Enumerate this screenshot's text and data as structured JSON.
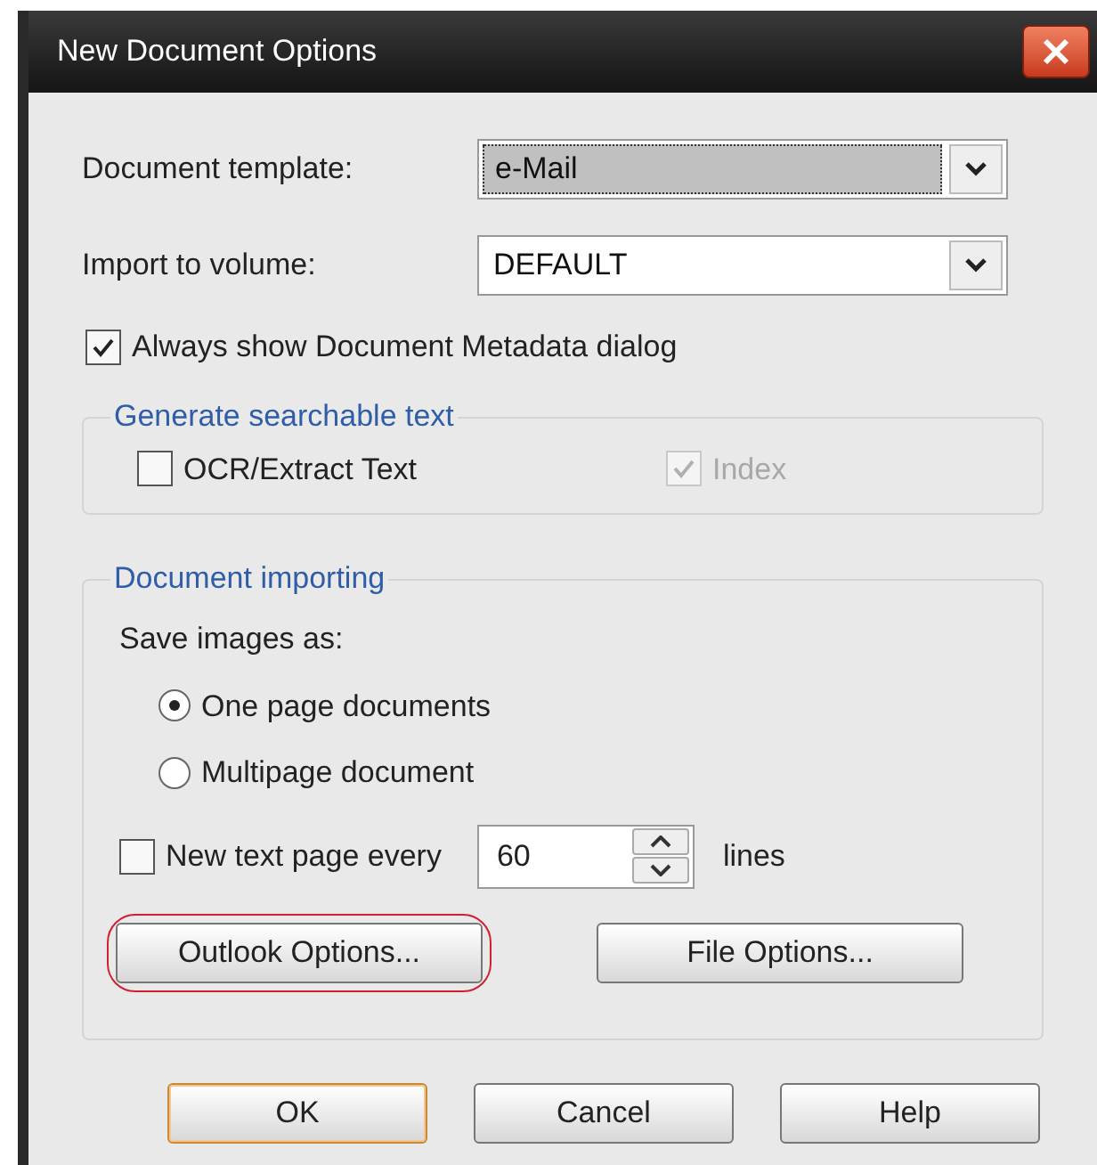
{
  "window": {
    "title": "New Document Options"
  },
  "fields": [
    {
      "label": "Document template:",
      "value": "e-Mail",
      "focused": true
    },
    {
      "label": "Import to volume:",
      "value": "DEFAULT",
      "focused": false
    }
  ],
  "always_show": {
    "label": "Always show Document Metadata dialog",
    "checked": true,
    "disabled": false
  },
  "searchable_group": {
    "title": "Generate searchable text",
    "options": [
      {
        "label": "OCR/Extract Text",
        "checked": false,
        "disabled": false
      },
      {
        "label": "Index",
        "checked": true,
        "disabled": true
      }
    ]
  },
  "importing_group": {
    "title": "Document importing",
    "save_label": "Save images as:",
    "radios": [
      {
        "label": "One page documents",
        "selected": true
      },
      {
        "label": "Multipage document",
        "selected": false
      }
    ],
    "new_page": {
      "label": "New text page every",
      "checked": false,
      "disabled": false,
      "value": "60",
      "unit": "lines"
    },
    "buttons": [
      {
        "label": "Outlook Options...",
        "highlighted": true
      },
      {
        "label": "File Options...",
        "highlighted": false
      }
    ]
  },
  "buttons": [
    {
      "label": "OK",
      "default": true
    },
    {
      "label": "Cancel",
      "default": false
    },
    {
      "label": "Help",
      "default": false
    }
  ]
}
